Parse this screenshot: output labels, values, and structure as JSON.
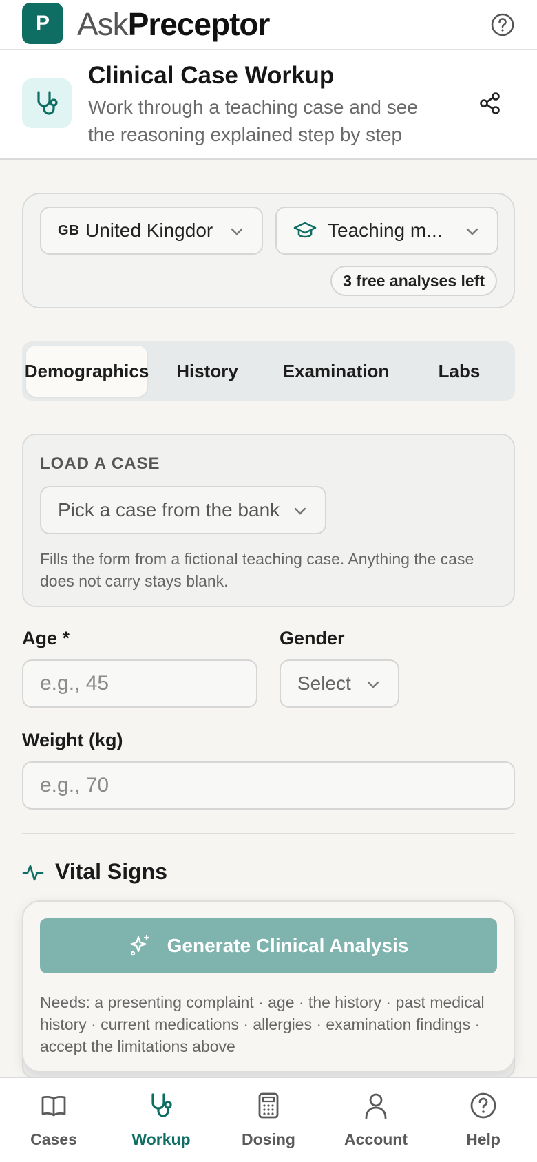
{
  "app": {
    "logo_letter": "P",
    "brand_ask": "Ask",
    "brand_preceptor": "Preceptor"
  },
  "header": {
    "title": "Clinical Case Workup",
    "subtitle": "Work through a teaching case and see the reasoning explained step by step"
  },
  "settings": {
    "country_code": "GB",
    "country": "United Kingdor",
    "mode": "Teaching m...",
    "free_badge": "3 free analyses left"
  },
  "tabs": [
    {
      "label": "Demographics",
      "active": true
    },
    {
      "label": "History",
      "active": false
    },
    {
      "label": "Examination",
      "active": false
    },
    {
      "label": "Labs",
      "active": false
    }
  ],
  "load_case": {
    "title": "LOAD A CASE",
    "select_placeholder": "Pick a case from the bank",
    "help": "Fills the form from a fictional teaching case. Anything the case does not carry stays blank."
  },
  "form": {
    "age_label": "Age *",
    "age_placeholder": "e.g., 45",
    "gender_label": "Gender",
    "gender_value": "Select",
    "weight_label": "Weight (kg)",
    "weight_placeholder": "e.g., 70"
  },
  "vitals": {
    "title": "Vital Signs"
  },
  "generate": {
    "button": "Generate Clinical Analysis",
    "note": "Needs: a presenting complaint · age · the history · past medical history · current medications · allergies · examination findings · accept the limitations above"
  },
  "colors": {
    "brand": "#0f6e64",
    "button_disabled": "#7fb3ae",
    "background": "#f6f5f1"
  },
  "nav": [
    {
      "label": "Cases",
      "icon": "book-icon",
      "active": false
    },
    {
      "label": "Workup",
      "icon": "stethoscope-icon",
      "active": true
    },
    {
      "label": "Dosing",
      "icon": "calculator-icon",
      "active": false
    },
    {
      "label": "Account",
      "icon": "user-icon",
      "active": false
    },
    {
      "label": "Help",
      "icon": "help-icon",
      "active": false
    }
  ]
}
